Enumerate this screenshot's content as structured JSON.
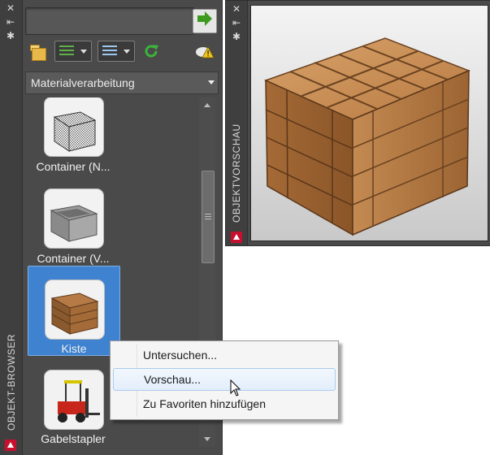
{
  "object_browser": {
    "title": "OBJEKT-BROWSER",
    "search": {
      "value": "",
      "placeholder": ""
    },
    "category": "Materialverarbeitung",
    "items": [
      {
        "label": "Container (N..."
      },
      {
        "label": "Container (V..."
      },
      {
        "label": "Kiste",
        "selected": true
      },
      {
        "label": "Gabelstapler"
      }
    ]
  },
  "preview": {
    "title": "OBJEKTVORSCHAU"
  },
  "context_menu": {
    "items": [
      {
        "label": "Untersuchen..."
      },
      {
        "label": "Vorschau...",
        "highlighted": true
      },
      {
        "label": "Zu Favoriten hinzufügen"
      }
    ]
  },
  "icons": {
    "close": "close-icon",
    "pin": "autohide-icon",
    "settings": "properties-icon",
    "search_go": "green-arrow-icon",
    "folder": "folder-icon",
    "refresh": "refresh-icon",
    "cloud": "cloud-warning-icon"
  },
  "colors": {
    "panel_bg": "#4a4a4a",
    "selection": "#3e82d0",
    "menu_bg": "#f5f5f5",
    "menu_hover": "#e3eefb"
  }
}
